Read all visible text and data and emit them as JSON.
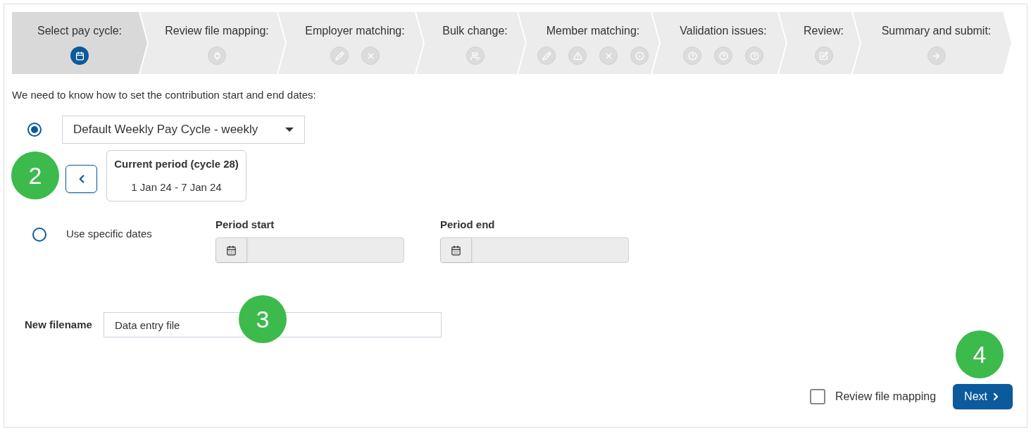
{
  "steps": [
    {
      "label": "Select pay cycle:",
      "selected": true,
      "icons": [
        {
          "kind": "calendar"
        }
      ]
    },
    {
      "label": "Review file mapping:",
      "selected": false,
      "icons": [
        {
          "kind": "plug"
        }
      ]
    },
    {
      "label": "Employer matching:",
      "selected": false,
      "icons": [
        {
          "kind": "pencil"
        },
        {
          "kind": "cross"
        }
      ]
    },
    {
      "label": "Bulk change:",
      "selected": false,
      "icons": [
        {
          "kind": "users"
        }
      ]
    },
    {
      "label": "Member matching:",
      "selected": false,
      "icons": [
        {
          "kind": "pencil"
        },
        {
          "kind": "warning"
        },
        {
          "kind": "cross"
        },
        {
          "kind": "info"
        }
      ]
    },
    {
      "label": "Validation issues:",
      "selected": false,
      "icons": [
        {
          "kind": "question"
        },
        {
          "kind": "question"
        },
        {
          "kind": "question"
        }
      ]
    },
    {
      "label": "Review:",
      "selected": false,
      "icons": [
        {
          "kind": "edit"
        }
      ]
    },
    {
      "label": "Summary and submit:",
      "selected": false,
      "icons": [
        {
          "kind": "arrow"
        }
      ]
    }
  ],
  "intro": "We need to know how to set the contribution start and end dates:",
  "pay_cycle_option": {
    "selected": true,
    "dropdown_value": "Default Weekly Pay Cycle - weekly",
    "period_title": "Current period (cycle 28)",
    "period_dates": "1 Jan 24 - 7 Jan 24"
  },
  "specific_dates_option": {
    "selected": false,
    "label": "Use specific dates",
    "fields": [
      "Period start",
      "Period end"
    ]
  },
  "filename": {
    "label": "New filename",
    "value": "Data entry file"
  },
  "review_checkbox": {
    "label": "Review file mapping",
    "checked": false
  },
  "next_button": "Next",
  "callouts": [
    "2",
    "3",
    "4"
  ]
}
